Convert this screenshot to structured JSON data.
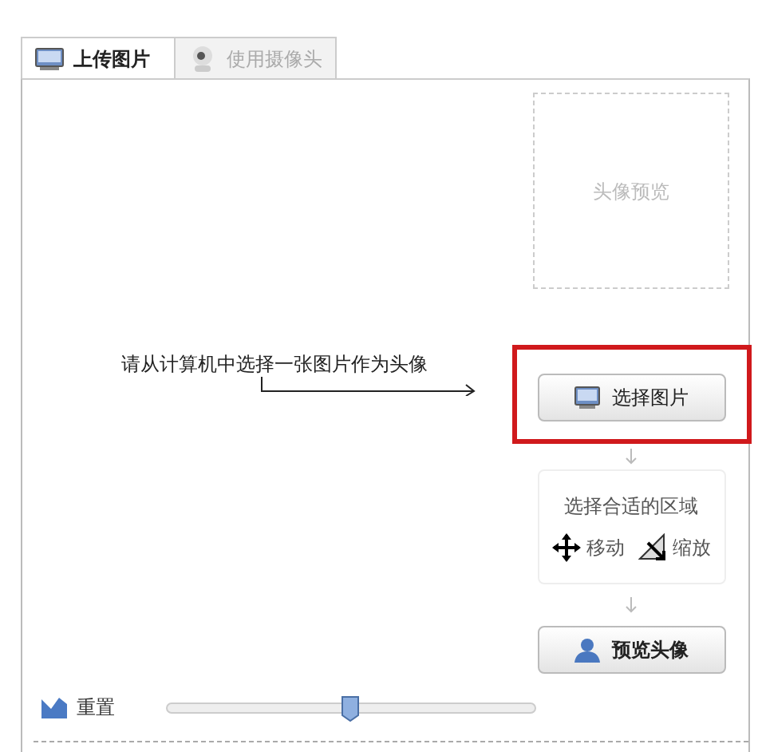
{
  "tabs": [
    {
      "label": "上传图片",
      "selected": true
    },
    {
      "label": "使用摄像头",
      "selected": false
    }
  ],
  "preview_box": {
    "label": "头像预览"
  },
  "instruction": "请从计算机中选择一张图片作为头像",
  "choose_button": {
    "label": "选择图片",
    "highlighted": true
  },
  "region_box": {
    "title": "选择合适的区域",
    "move": "移动",
    "zoom": "缩放"
  },
  "preview_button": {
    "label": "预览头像"
  },
  "reset": {
    "label": "重置"
  },
  "slider": {
    "level": 0.5
  }
}
